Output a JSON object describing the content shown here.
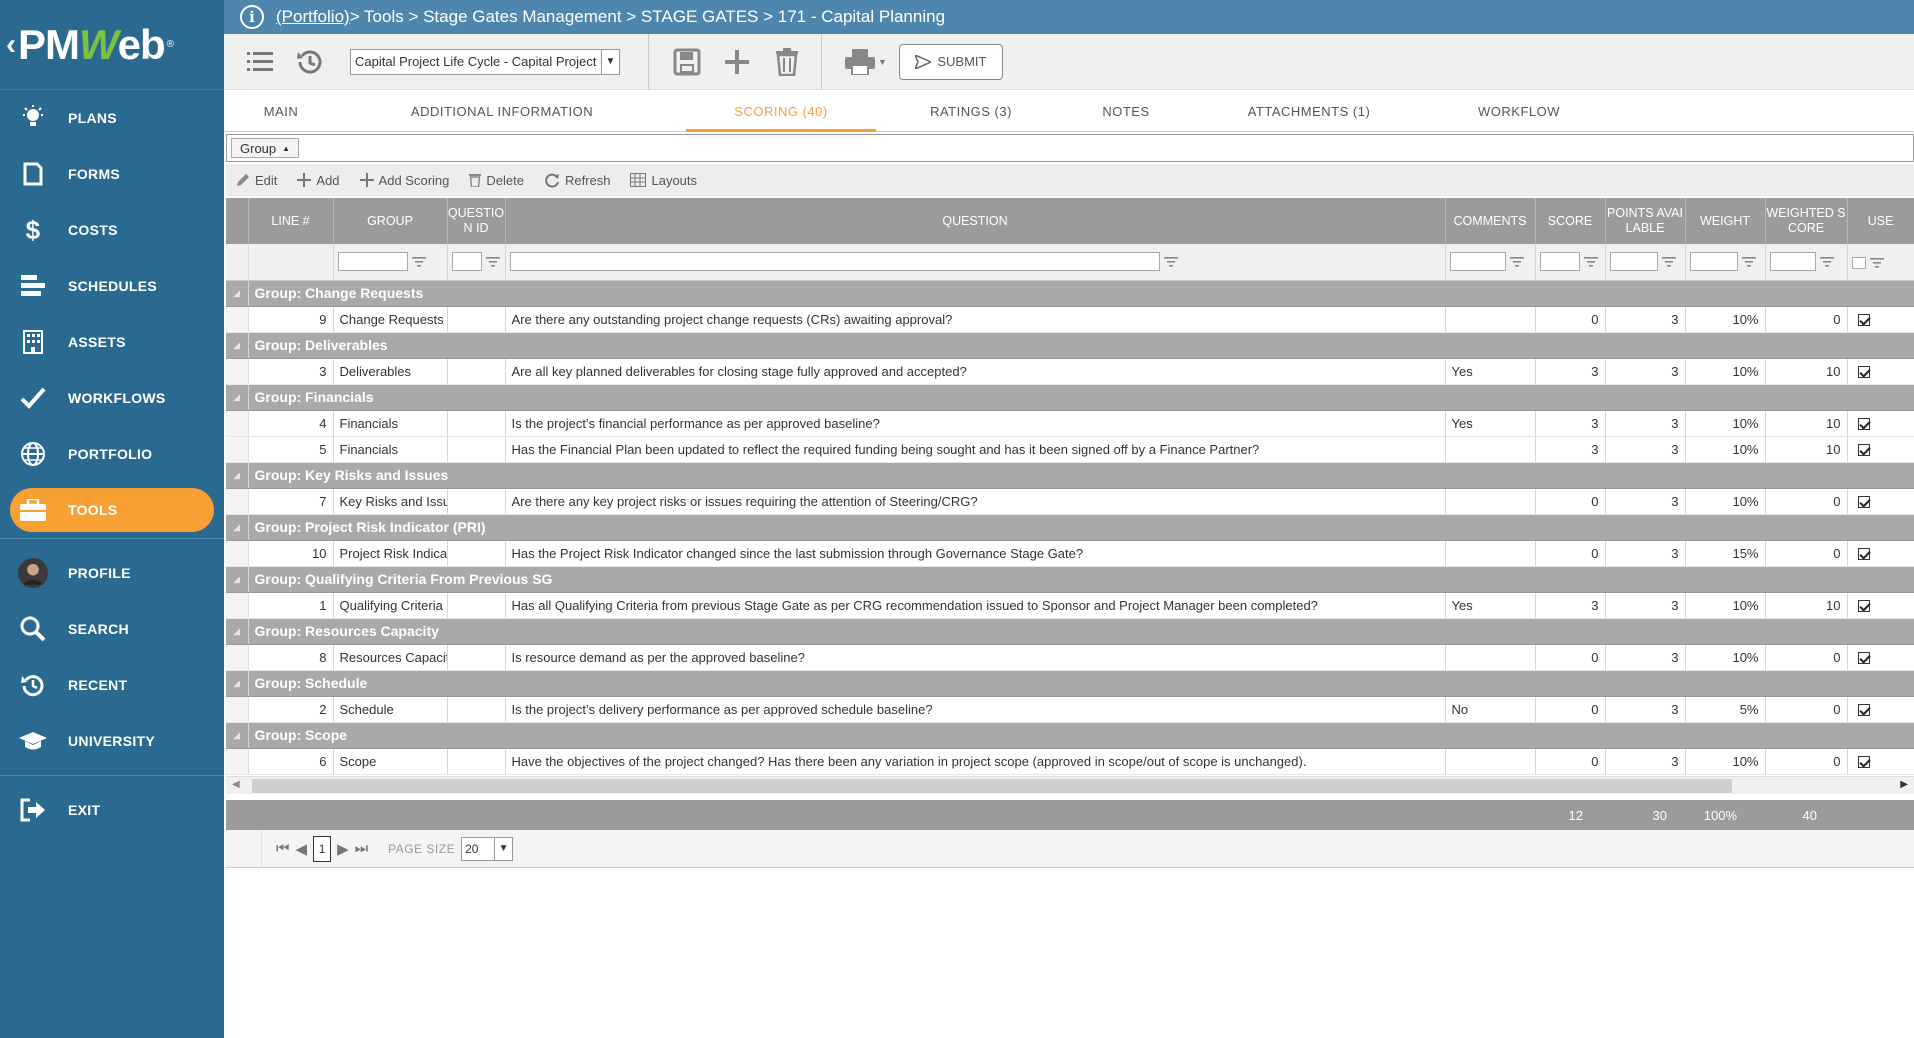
{
  "app": {
    "logo_text": "PMWeb",
    "registered": "®",
    "back_glyph": "‹"
  },
  "sidebar": {
    "items": [
      {
        "label": "PLANS",
        "icon": "lightbulb-icon"
      },
      {
        "label": "FORMS",
        "icon": "document-icon"
      },
      {
        "label": "COSTS",
        "icon": "dollar-icon"
      },
      {
        "label": "SCHEDULES",
        "icon": "schedule-bars-icon"
      },
      {
        "label": "ASSETS",
        "icon": "building-icon"
      },
      {
        "label": "WORKFLOWS",
        "icon": "checkmark-icon"
      },
      {
        "label": "PORTFOLIO",
        "icon": "globe-icon"
      },
      {
        "label": "TOOLS",
        "icon": "briefcase-icon",
        "active": true
      }
    ],
    "secondary": [
      {
        "label": "PROFILE",
        "icon": "avatar-icon"
      },
      {
        "label": "SEARCH",
        "icon": "search-icon"
      },
      {
        "label": "RECENT",
        "icon": "history-icon"
      },
      {
        "label": "UNIVERSITY",
        "icon": "graduation-cap-icon"
      }
    ],
    "exit": {
      "label": "EXIT",
      "icon": "exit-icon"
    }
  },
  "breadcrumb": {
    "link": "(Portfolio)",
    "rest": " > Tools > Stage Gates Management > STAGE GATES > 171 - Capital Planning"
  },
  "toolbar": {
    "cycle_value": "Capital Project Life Cycle  - Capital Project Life Cycle",
    "submit_label": "SUBMIT"
  },
  "tabs": [
    {
      "label": "MAIN"
    },
    {
      "label": "ADDITIONAL INFORMATION"
    },
    {
      "label": "SCORING (40)",
      "active": true
    },
    {
      "label": "RATINGS (3)"
    },
    {
      "label": "NOTES"
    },
    {
      "label": "ATTACHMENTS (1)"
    },
    {
      "label": "WORKFLOW"
    }
  ],
  "group_chip": {
    "label": "Group",
    "sort": "▲"
  },
  "actions": {
    "edit": "Edit",
    "add": "Add",
    "add_scoring": "Add Scoring",
    "delete": "Delete",
    "refresh": "Refresh",
    "layouts": "Layouts"
  },
  "columns": [
    "LINE #",
    "GROUP",
    "QUESTION ID",
    "QUESTION",
    "COMMENTS",
    "SCORE",
    "POINTS AVAILABLE",
    "WEIGHT",
    "WEIGHTED SCORE",
    "USE"
  ],
  "groups": [
    {
      "title": "Group: Change Requests",
      "rows": [
        {
          "line": "9",
          "group": "Change Requests",
          "qid": "",
          "question": "Are there any outstanding project change requests (CRs) awaiting approval?",
          "comments": "",
          "score": "0",
          "points": "3",
          "weight": "10%",
          "wscore": "0",
          "use": true
        }
      ]
    },
    {
      "title": "Group: Deliverables",
      "rows": [
        {
          "line": "3",
          "group": "Deliverables",
          "qid": "",
          "question": "Are all key planned deliverables for closing stage fully approved and accepted?",
          "comments": "Yes",
          "score": "3",
          "points": "3",
          "weight": "10%",
          "wscore": "10",
          "use": true
        }
      ]
    },
    {
      "title": "Group: Financials",
      "rows": [
        {
          "line": "4",
          "group": "Financials",
          "qid": "",
          "question": "Is the project’s financial performance as per approved baseline?",
          "comments": "Yes",
          "score": "3",
          "points": "3",
          "weight": "10%",
          "wscore": "10",
          "use": true
        },
        {
          "line": "5",
          "group": "Financials",
          "qid": "",
          "question": "Has the Financial Plan been updated to reflect the required funding being sought and has it been signed off by a Finance Partner?",
          "comments": "",
          "score": "3",
          "points": "3",
          "weight": "10%",
          "wscore": "10",
          "use": true
        }
      ]
    },
    {
      "title": "Group: Key Risks and Issues",
      "rows": [
        {
          "line": "7",
          "group": "Key Risks and Issues",
          "qid": "",
          "question": "Are there any key project risks or issues requiring the attention of Steering/CRG?",
          "comments": "",
          "score": "0",
          "points": "3",
          "weight": "10%",
          "wscore": "0",
          "use": true
        }
      ]
    },
    {
      "title": "Group: Project Risk Indicator (PRI)",
      "rows": [
        {
          "line": "10",
          "group": "Project Risk Indicator (PRI)",
          "qid": "",
          "question": "Has the Project Risk Indicator changed since the last submission through Governance Stage Gate?",
          "comments": "",
          "score": "0",
          "points": "3",
          "weight": "15%",
          "wscore": "0",
          "use": true
        }
      ]
    },
    {
      "title": "Group: Qualifying Criteria From Previous SG",
      "rows": [
        {
          "line": "1",
          "group": "Qualifying Criteria From Previous SG",
          "qid": "",
          "question": "Has all Qualifying Criteria from previous Stage Gate as per CRG recommendation issued to Sponsor and Project Manager been completed?",
          "comments": "Yes",
          "score": "3",
          "points": "3",
          "weight": "10%",
          "wscore": "10",
          "use": true
        }
      ]
    },
    {
      "title": "Group: Resources Capacity",
      "rows": [
        {
          "line": "8",
          "group": "Resources Capacity",
          "qid": "",
          "question": "Is resource demand as per the approved baseline?",
          "comments": "",
          "score": "0",
          "points": "3",
          "weight": "10%",
          "wscore": "0",
          "use": true
        }
      ]
    },
    {
      "title": "Group: Schedule",
      "rows": [
        {
          "line": "2",
          "group": "Schedule",
          "qid": "",
          "question": "Is the project’s delivery performance as per approved schedule baseline?",
          "comments": "No",
          "score": "0",
          "points": "3",
          "weight": "5%",
          "wscore": "0",
          "use": true
        }
      ]
    },
    {
      "title": "Group: Scope",
      "rows": [
        {
          "line": "6",
          "group": "Scope",
          "qid": "",
          "question": "Have the objectives of the project changed?  Has there been any variation in project scope (approved in scope/out of scope is unchanged).",
          "comments": "",
          "score": "0",
          "points": "3",
          "weight": "10%",
          "wscore": "0",
          "use": true
        }
      ]
    }
  ],
  "totals": {
    "score": "12",
    "points": "30",
    "weight": "100%",
    "wscore": "40"
  },
  "pager": {
    "page": "1",
    "size_label": "PAGE SIZE",
    "size_value": "20"
  }
}
